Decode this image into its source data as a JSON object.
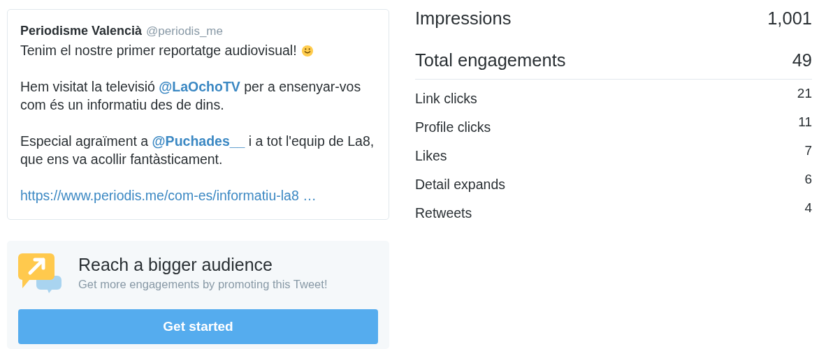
{
  "tweet": {
    "author": "Periodisme Valencià",
    "handle": "@periodis_me",
    "paragraphs": [
      [
        {
          "kind": "text",
          "text": "Tenim el nostre primer reportatge audiovisual!"
        },
        {
          "kind": "emoji"
        }
      ],
      [
        {
          "kind": "text",
          "text": "Hem visitat la televisió "
        },
        {
          "kind": "mention",
          "text": "@LaOchoTV"
        },
        {
          "kind": "text",
          "text": " per a ensenyar-vos com és un informatiu des de dins."
        }
      ],
      [
        {
          "kind": "text",
          "text": "Especial agraïment a "
        },
        {
          "kind": "mention",
          "text": "@Puchades__"
        },
        {
          "kind": "text",
          "text": " i a tot l'equip de La8, que ens va acollir fantàsticament."
        }
      ],
      [
        {
          "kind": "link",
          "text": "https://www.periodis.me/com-es/informatiu-la8 …"
        }
      ]
    ]
  },
  "promo": {
    "title": "Reach a bigger audience",
    "subtitle": "Get more engagements by promoting this Tweet!",
    "button": "Get started"
  },
  "impressions": {
    "label": "Impressions",
    "value": "1,001"
  },
  "total_engagements": {
    "label": "Total engagements",
    "value": "49"
  },
  "metrics": [
    {
      "label": "Link clicks",
      "value": "21"
    },
    {
      "label": "Profile clicks",
      "value": "11"
    },
    {
      "label": "Likes",
      "value": "7"
    },
    {
      "label": "Detail expands",
      "value": "6"
    },
    {
      "label": "Retweets",
      "value": "4"
    }
  ]
}
